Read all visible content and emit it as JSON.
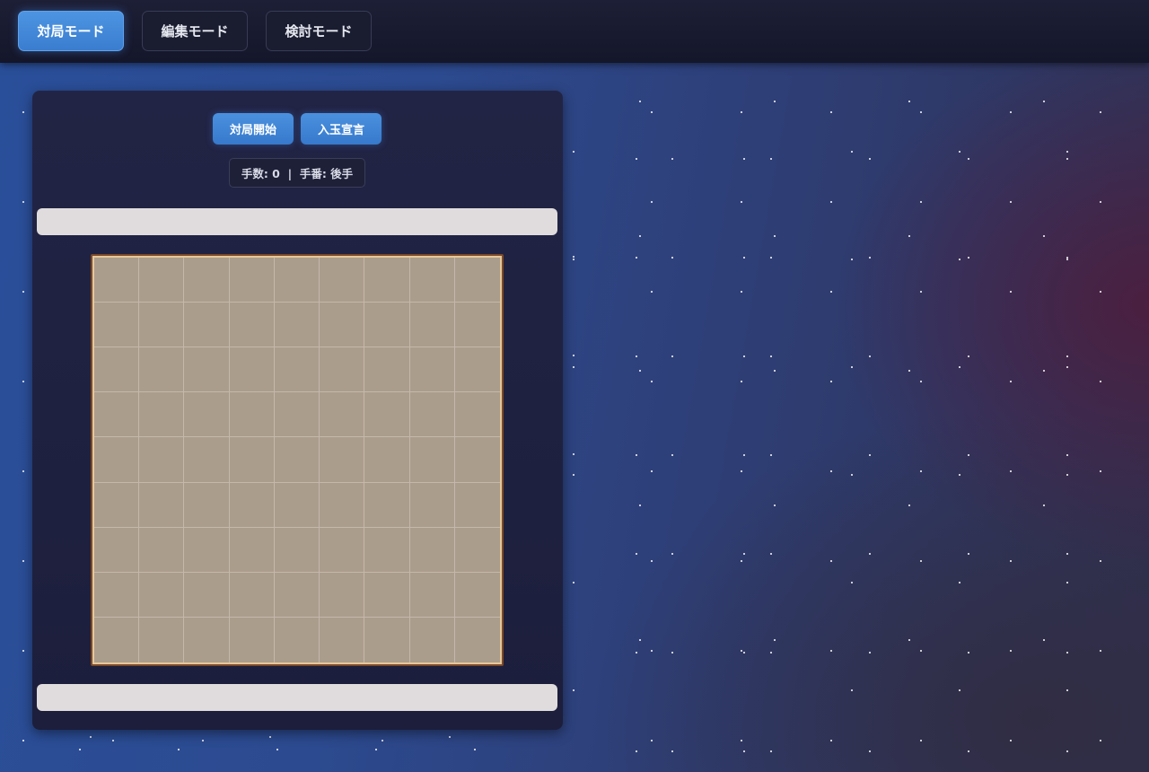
{
  "modes": [
    "対局モード",
    "編集モード",
    "検討モード"
  ],
  "active_mode": "対局モード",
  "actions": {
    "start_label": "対局開始",
    "declare_label": "入玉宣言"
  },
  "status": {
    "text": "手数: 0  |  手番: 後手",
    "move_count": 0,
    "turn": "後手"
  },
  "board": {
    "files": 9,
    "ranks": 9,
    "pieces": []
  },
  "hands": {
    "top": [],
    "bottom": []
  },
  "colors": {
    "accent": "#4a91df",
    "board": "#ab9d8c",
    "board_frame": "#7a4a28",
    "hand_bar": "#e0dcdd"
  }
}
